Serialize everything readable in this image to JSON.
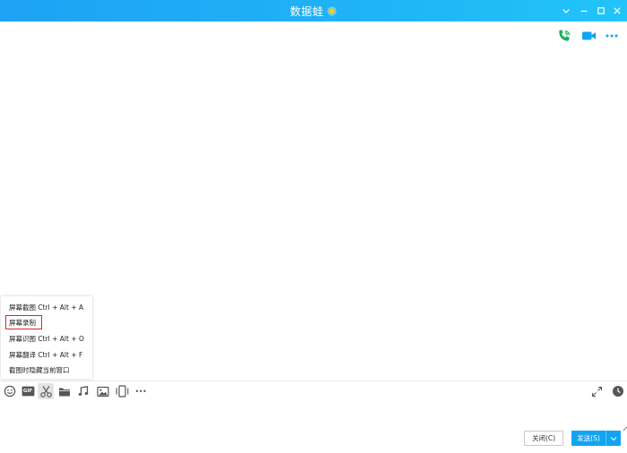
{
  "window": {
    "title": "数据蛙",
    "title_star_icon": "star-icon",
    "titlebar_color": "#1fb1f6",
    "controls": [
      "chevron-down-icon",
      "minimize-icon",
      "maximize-icon",
      "close-icon"
    ]
  },
  "top_actions": [
    "voice-call-icon",
    "video-call-icon",
    "more-icon"
  ],
  "screenshot_menu": {
    "items": [
      {
        "label": "屏幕截图 Ctrl + Alt + A"
      },
      {
        "label": "屏幕录制"
      },
      {
        "label": "屏幕识图 Ctrl + Alt + O"
      },
      {
        "label": "屏幕翻译 Ctrl + Alt + F"
      },
      {
        "label": "截图时隐藏当前窗口"
      }
    ],
    "highlighted_index": 1,
    "highlight_color": "#d9262b"
  },
  "toolbar": {
    "icons": [
      "emoji-icon",
      "gif-icon",
      "scissors-icon",
      "folder-icon",
      "music-icon",
      "image-icon",
      "phone-screen-icon",
      "more-icon"
    ],
    "gif_label": "GIF",
    "more_label": "•••",
    "right_icons": [
      "expand-icon",
      "history-clock-icon"
    ]
  },
  "footer": {
    "close_label": "关闭(C)",
    "send_label": "发送(S)",
    "send_color": "#12a4f0"
  }
}
